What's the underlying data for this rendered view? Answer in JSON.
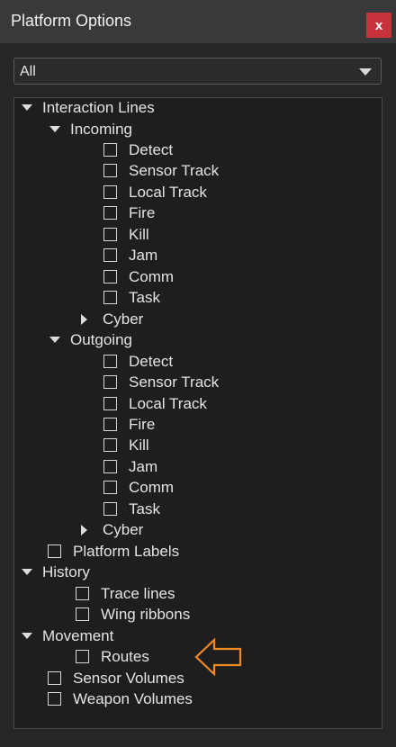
{
  "window": {
    "title": "Platform Options",
    "close_label": "x"
  },
  "filter": {
    "value": "All"
  },
  "tree": {
    "interaction_lines": "Interaction Lines",
    "incoming": {
      "label": "Incoming",
      "items": [
        "Detect",
        "Sensor Track",
        "Local Track",
        "Fire",
        "Kill",
        "Jam",
        "Comm",
        "Task"
      ],
      "cyber": "Cyber"
    },
    "outgoing": {
      "label": "Outgoing",
      "items": [
        "Detect",
        "Sensor Track",
        "Local Track",
        "Fire",
        "Kill",
        "Jam",
        "Comm",
        "Task"
      ],
      "cyber": "Cyber"
    },
    "platform_labels": "Platform Labels",
    "history": {
      "label": "History",
      "items": [
        "Trace lines",
        "Wing ribbons"
      ]
    },
    "movement": {
      "label": "Movement",
      "items": [
        "Routes"
      ]
    },
    "sensor_volumes": "Sensor Volumes",
    "weapon_volumes": "Weapon Volumes"
  },
  "colors": {
    "annotation_arrow": "#f08a24",
    "close_button": "#c8323a"
  }
}
